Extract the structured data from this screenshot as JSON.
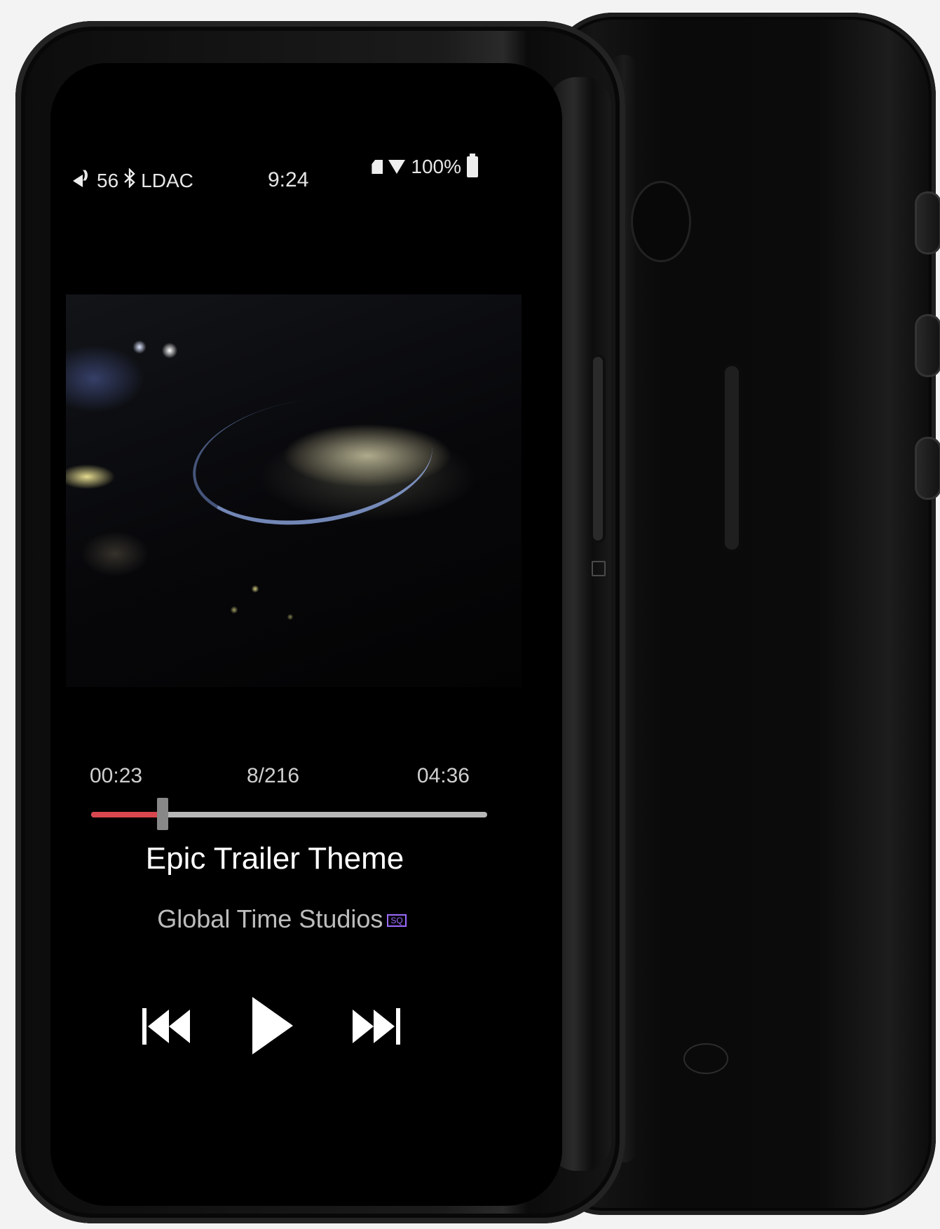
{
  "status_bar": {
    "volume": "56",
    "codec": "LDAC",
    "time": "9:24",
    "battery": "100%",
    "icons": [
      "speaker-icon",
      "bluetooth-icon",
      "sd-card-icon",
      "wifi-icon",
      "battery-icon"
    ]
  },
  "player": {
    "elapsed": "00:23",
    "track_index": "8/216",
    "total": "04:36",
    "progress_fraction": 0.18,
    "title": "Epic Trailer Theme",
    "artist": "Global Time Studios",
    "quality_badge": "SQ",
    "controls": {
      "prev_icon": "skip-previous-icon",
      "play_icon": "play-icon",
      "next_icon": "skip-next-icon"
    }
  },
  "colors": {
    "progress_played": "#d8464e",
    "progress_remaining": "#b8b8b8",
    "badge": "#9b6cff"
  }
}
